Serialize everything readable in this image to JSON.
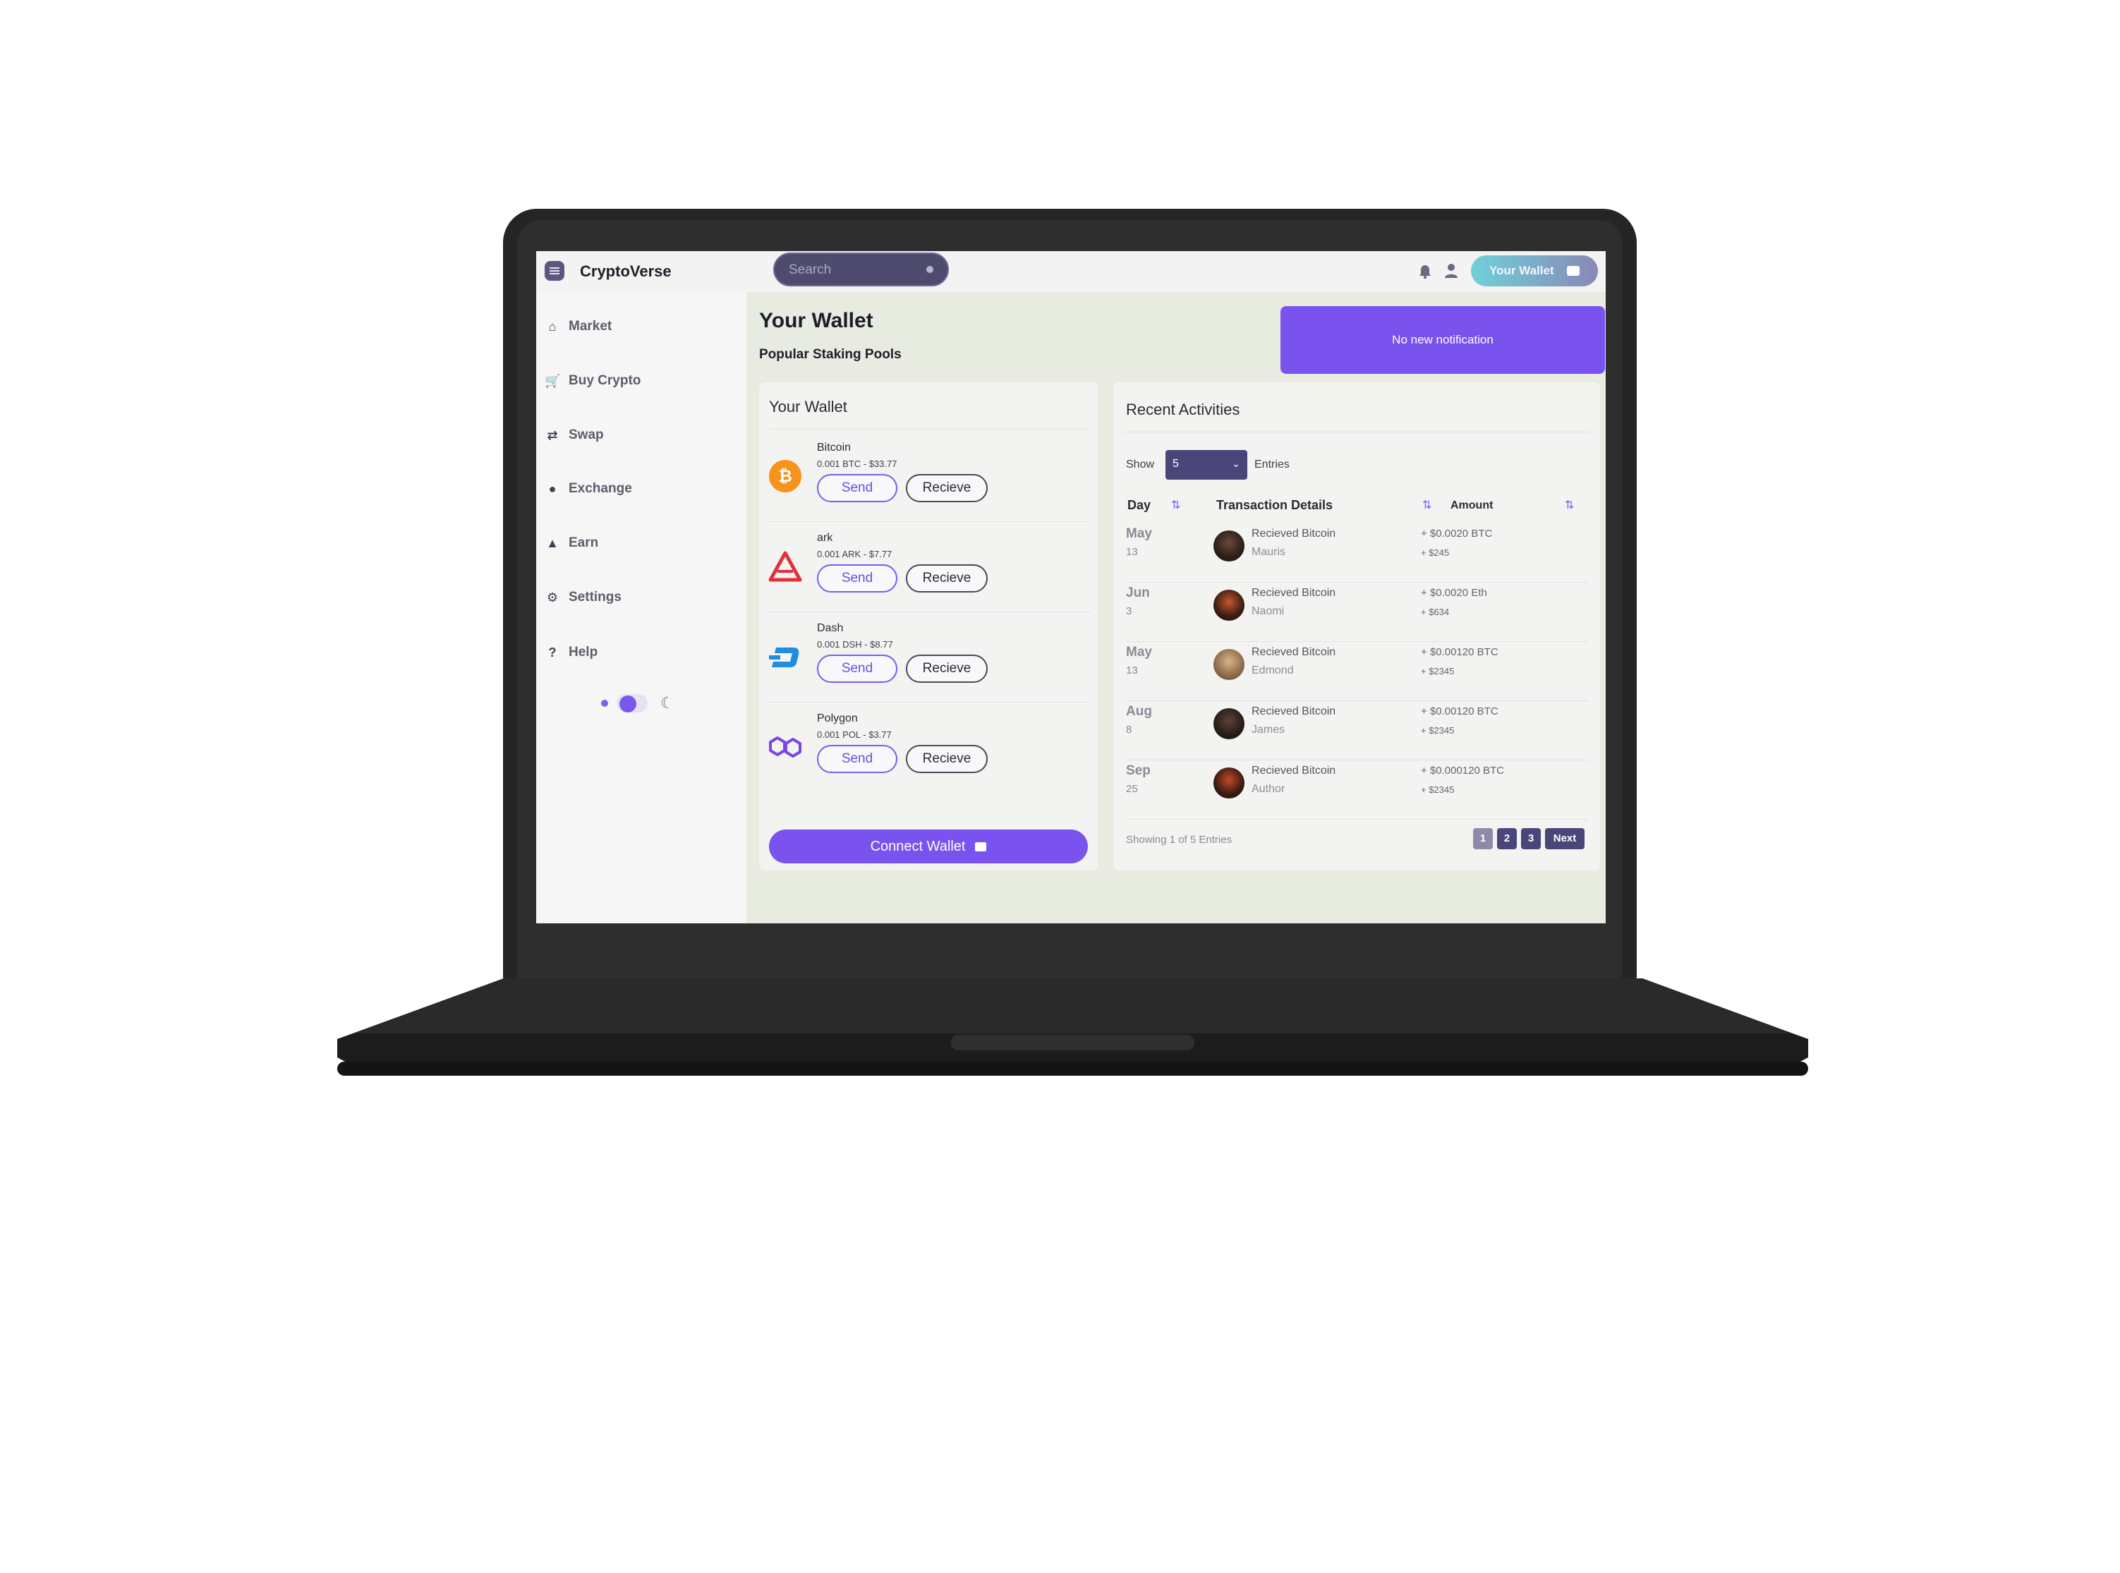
{
  "app": {
    "brand": "CryptoVerse"
  },
  "header": {
    "search_placeholder": "Search",
    "wallet_button": "Your Wallet"
  },
  "sidebar": {
    "items": [
      {
        "label": "Market",
        "icon": "home-icon"
      },
      {
        "label": "Buy Crypto",
        "icon": "cart-icon"
      },
      {
        "label": "Swap",
        "icon": "swap-icon"
      },
      {
        "label": "Exchange",
        "icon": "exchange-icon"
      },
      {
        "label": "Earn",
        "icon": "earn-icon"
      },
      {
        "label": "Settings",
        "icon": "gear-icon"
      },
      {
        "label": "Help",
        "icon": "help-icon"
      }
    ]
  },
  "main": {
    "title": "Your Wallet",
    "subtitle": "Popular Staking Pools",
    "notification": "No new notification"
  },
  "wallet": {
    "title": "Your Wallet",
    "send_label": "Send",
    "receive_label": "Recieve",
    "connect_label": "Connect Wallet",
    "coins": [
      {
        "name": "Bitcoin",
        "amount": "0.001 BTC - $33.77",
        "icon": "bitcoin-icon",
        "color": "#f7931a"
      },
      {
        "name": "ark",
        "amount": "0.001 ARK - $7.77",
        "icon": "ark-icon",
        "color": "#e0313a"
      },
      {
        "name": "Dash",
        "amount": "0.001 DSH - $8.77",
        "icon": "dash-icon",
        "color": "#1c8de0"
      },
      {
        "name": "Polygon",
        "amount": "0.001 POL - $3.77",
        "icon": "polygon-icon",
        "color": "#7b45e6"
      }
    ]
  },
  "activities": {
    "title": "Recent Activities",
    "show_label": "Show",
    "entries_value": "5",
    "entries_label": "Entries",
    "columns": [
      "Day",
      "Transaction Details",
      "Amount"
    ],
    "rows": [
      {
        "month": "May",
        "day": "13",
        "desc": "Recieved Bitcoin",
        "who": "Mauris",
        "amount": "+ $0.0020 BTC",
        "usd": "+ $245"
      },
      {
        "month": "Jun",
        "day": "3",
        "desc": "Recieved Bitcoin",
        "who": "Naomi",
        "amount": "+ $0.0020 Eth",
        "usd": "+ $634"
      },
      {
        "month": "May",
        "day": "13",
        "desc": "Recieved Bitcoin",
        "who": "Edmond",
        "amount": "+ $0.00120 BTC",
        "usd": "+ $2345"
      },
      {
        "month": "Aug",
        "day": "8",
        "desc": "Recieved Bitcoin",
        "who": "James",
        "amount": "+ $0.00120 BTC",
        "usd": "+ $2345"
      },
      {
        "month": "Sep",
        "day": "25",
        "desc": "Recieved Bitcoin",
        "who": "Author",
        "amount": "+ $0.000120 BTC",
        "usd": "+ $2345"
      }
    ],
    "footer": "Showing 1 of 5 Entries",
    "pages": [
      "1",
      "2",
      "3"
    ],
    "next_label": "Next"
  },
  "colors": {
    "accent": "#7a52ee",
    "select": "#4b467a",
    "main_bg": "#e8ebe0"
  }
}
